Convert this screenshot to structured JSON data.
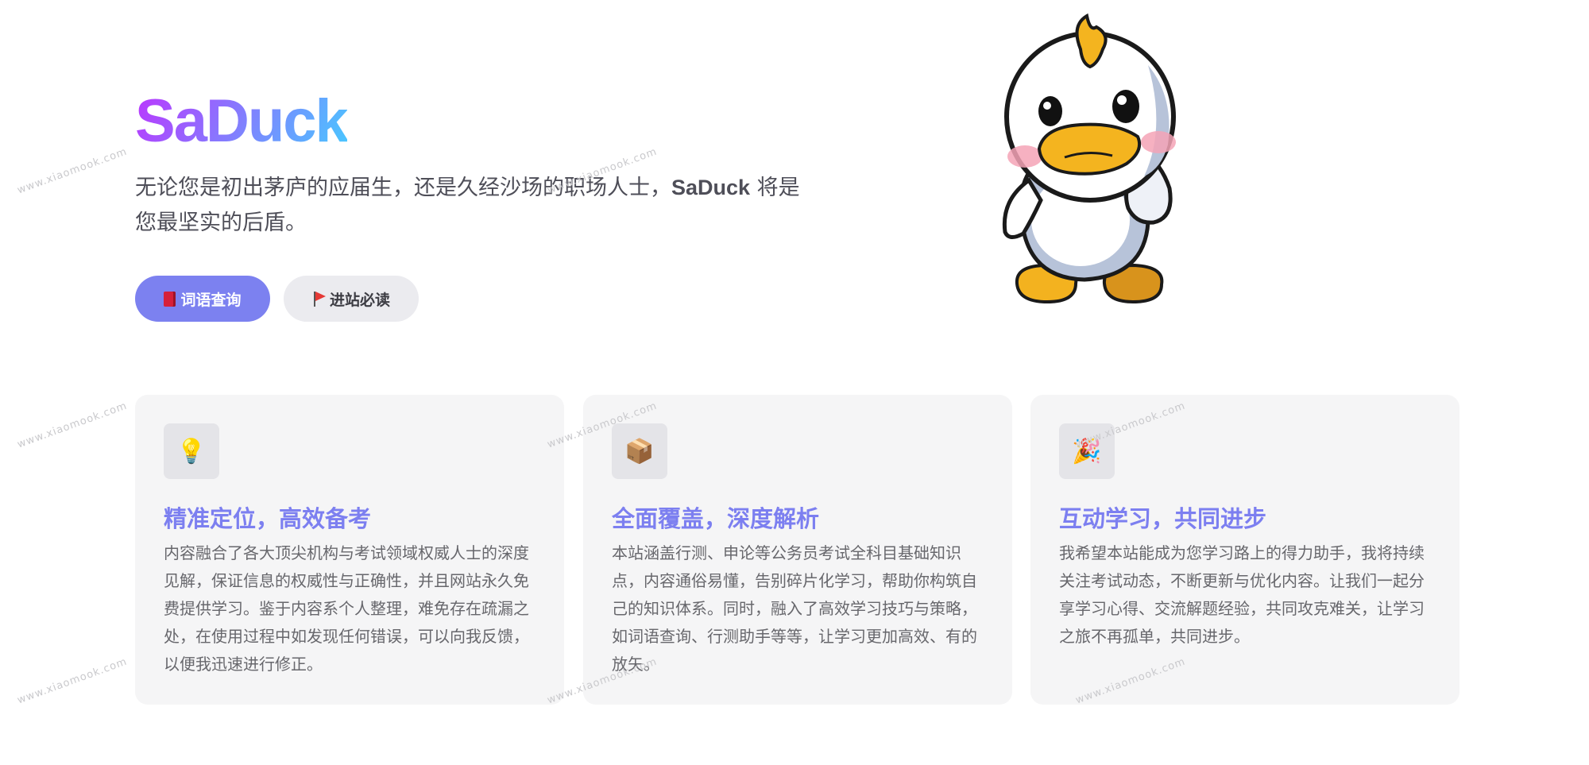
{
  "hero": {
    "title": "SaDuck",
    "tagline_prefix": "无论您是初出茅庐的应届生，还是久经沙场的职场人士，",
    "tagline_brand": "SaDuck",
    "tagline_suffix": " 将是您最坚实的后盾。",
    "image_name": "duck-mascot"
  },
  "actions": [
    {
      "label": "词语查询",
      "icon": "book-icon",
      "style": "brand",
      "color": "#7c81f0"
    },
    {
      "label": "进站必读",
      "icon": "flag-icon",
      "style": "alt",
      "color": "#ebebef"
    }
  ],
  "features": [
    {
      "icon": "lightbulb-icon",
      "icon_glyph": "💡",
      "title": "精准定位，高效备考",
      "details": "内容融合了各大顶尖机构与考试领域权威人士的深度见解，保证信息的权威性与正确性，并且网站永久免费提供学习。鉴于内容系个人整理，难免存在疏漏之处，在使用过程中如发现任何错误，可以向我反馈，以便我迅速进行修正。"
    },
    {
      "icon": "package-icon",
      "icon_glyph": "📦",
      "title": "全面覆盖，深度解析",
      "details": "本站涵盖行测、申论等公务员考试全科目基础知识点，内容通俗易懂，告别碎片化学习，帮助你构筑自己的知识体系。同时，融入了高效学习技巧与策略，如词语查询、行测助手等等，让学习更加高效、有的放矢。"
    },
    {
      "icon": "party-popper-icon",
      "icon_glyph": "🎉",
      "title": "互动学习，共同进步",
      "details": "我希望本站能成为您学习路上的得力助手，我将持续关注考试动态，不断更新与优化内容。让我们一起分享学习心得、交流解题经验，共同攻克难关，让学习之旅不再孤单，共同进步。"
    }
  ],
  "watermark": "www.xiaomook.com",
  "colors": {
    "accent": "#7c7ff0",
    "title_gradient_start": "#bd34fe",
    "title_gradient_end": "#47caff",
    "card_bg": "#f5f5f6"
  }
}
